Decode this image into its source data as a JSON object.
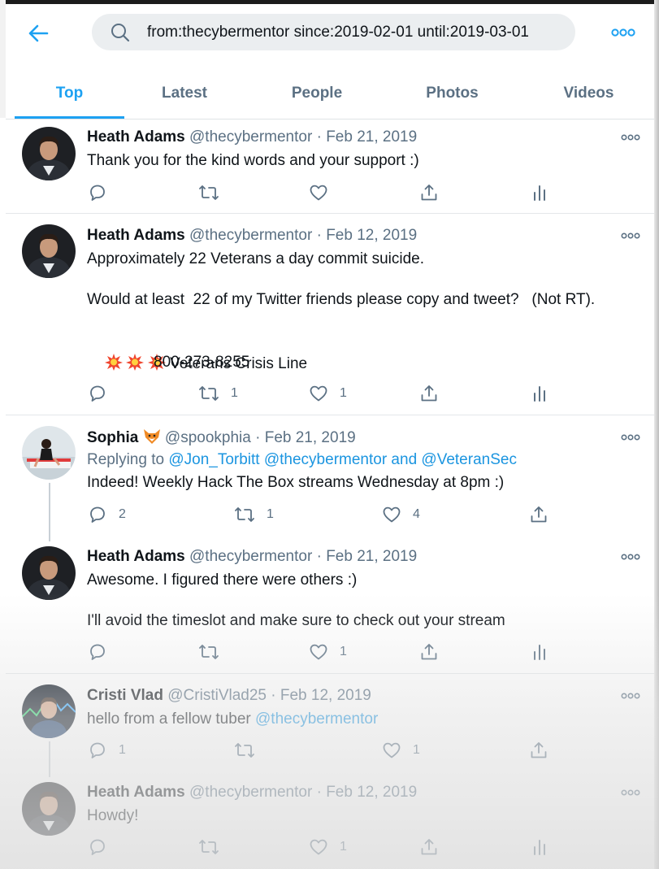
{
  "search": {
    "query": "from:thecybermentor since:2019-02-01 until:2019-03-01"
  },
  "tabs": [
    "Top",
    "Latest",
    "People",
    "Photos",
    "Videos"
  ],
  "active_tab": "Top",
  "colors": {
    "accent": "#1da1f2",
    "link": "#1b95e0",
    "secondary_text": "#5b7083",
    "search_bg": "#ebeef0"
  },
  "icons": [
    "back-arrow-icon",
    "search-icon",
    "more-icon",
    "reply-icon",
    "retweet-icon",
    "like-icon",
    "share-icon",
    "analytics-icon",
    "fox-emoji",
    "collision-emoji"
  ],
  "tweets": [
    {
      "name": "Heath Adams",
      "handle": "@thecybermentor",
      "sep": " · ",
      "date": "Feb 21, 2019",
      "text": "Thank you for the kind words and your support :)",
      "reply": "",
      "retweet": "",
      "like": ""
    },
    {
      "name": "Heath Adams",
      "handle": "@thecybermentor",
      "sep": " · ",
      "date": "Feb 12, 2019",
      "text1": "Approximately 22 Veterans a day commit suicide.",
      "text2": "Would at least  22 of my Twitter friends please copy and tweet?   (Not RT).",
      "text3": "Veterans Crisis Line",
      "text4": "800-273-8255",
      "reply": "",
      "retweet": "1",
      "like": "1"
    },
    {
      "name": "Sophia",
      "handle": "@spookphia",
      "sep": " · ",
      "date": "Feb 21, 2019",
      "replying_prefix": "Replying to ",
      "replying_user1": "@Jon_Torbitt",
      "replying_user2": "@thecybermentor",
      "replying_and": " and ",
      "replying_user3": "@VeteranSec",
      "text": "Indeed! Weekly Hack The Box streams Wednesday at 8pm :)",
      "reply": "2",
      "retweet": "1",
      "like": "4"
    },
    {
      "name": "Heath Adams",
      "handle": "@thecybermentor",
      "sep": " · ",
      "date": "Feb 21, 2019",
      "text1": "Awesome. I figured there were others :)",
      "text2": "I'll avoid the timeslot and make sure to check out your stream",
      "reply": "",
      "retweet": "",
      "like": "1"
    },
    {
      "name": "Cristi Vlad",
      "handle": "@CristiVlad25",
      "sep": " · ",
      "date": "Feb 12, 2019",
      "text_prefix": "hello from a fellow tuber ",
      "mention": "@thecybermentor",
      "reply": "1",
      "retweet": "",
      "like": "1"
    },
    {
      "name": "Heath Adams",
      "handle": "@thecybermentor",
      "sep": " · ",
      "date": "Feb 12, 2019",
      "text": "Howdy!",
      "reply": "",
      "retweet": "",
      "like": "1"
    }
  ]
}
